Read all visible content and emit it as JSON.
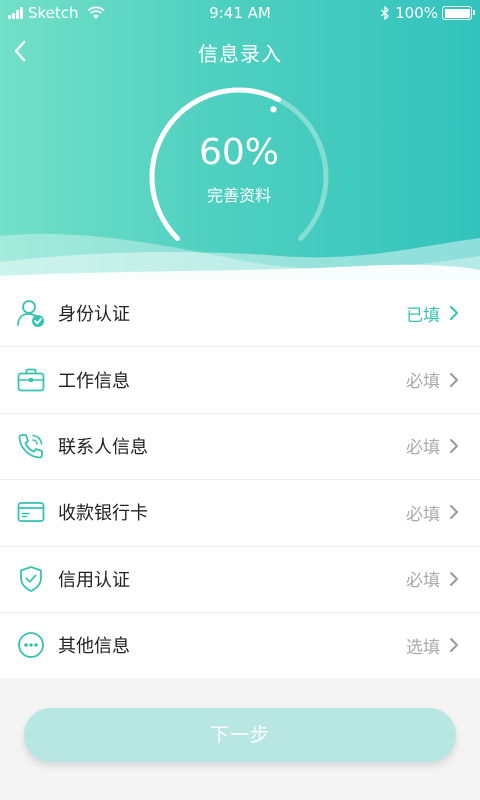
{
  "status_bar": {
    "carrier": "Sketch",
    "time": "9:41 AM",
    "battery": "100%"
  },
  "nav": {
    "title": "信息录入",
    "back_icon": "chevron-left-icon"
  },
  "progress": {
    "value_text": "60%",
    "fraction": 0.6,
    "label": "完善资料"
  },
  "list": [
    {
      "label": "身份认证",
      "status": "已填",
      "icon": "user-verified-icon",
      "completed": true
    },
    {
      "label": "工作信息",
      "status": "必填",
      "icon": "briefcase-icon",
      "completed": false
    },
    {
      "label": "联系人信息",
      "status": "必填",
      "icon": "phone-icon",
      "completed": false
    },
    {
      "label": "收款银行卡",
      "status": "必填",
      "icon": "bank-card-icon",
      "completed": false
    },
    {
      "label": "信用认证",
      "status": "必填",
      "icon": "shield-check-icon",
      "completed": false
    },
    {
      "label": "其他信息",
      "status": "选填",
      "icon": "more-dots-icon",
      "completed": false
    }
  ],
  "next_button": "下一步",
  "colors": {
    "accent": "#35c3b3",
    "header_start": "#73e0c8",
    "header_end": "#33c3bd",
    "button_disabled": "#b8e6e3",
    "muted_status": "#aaaaaa"
  }
}
